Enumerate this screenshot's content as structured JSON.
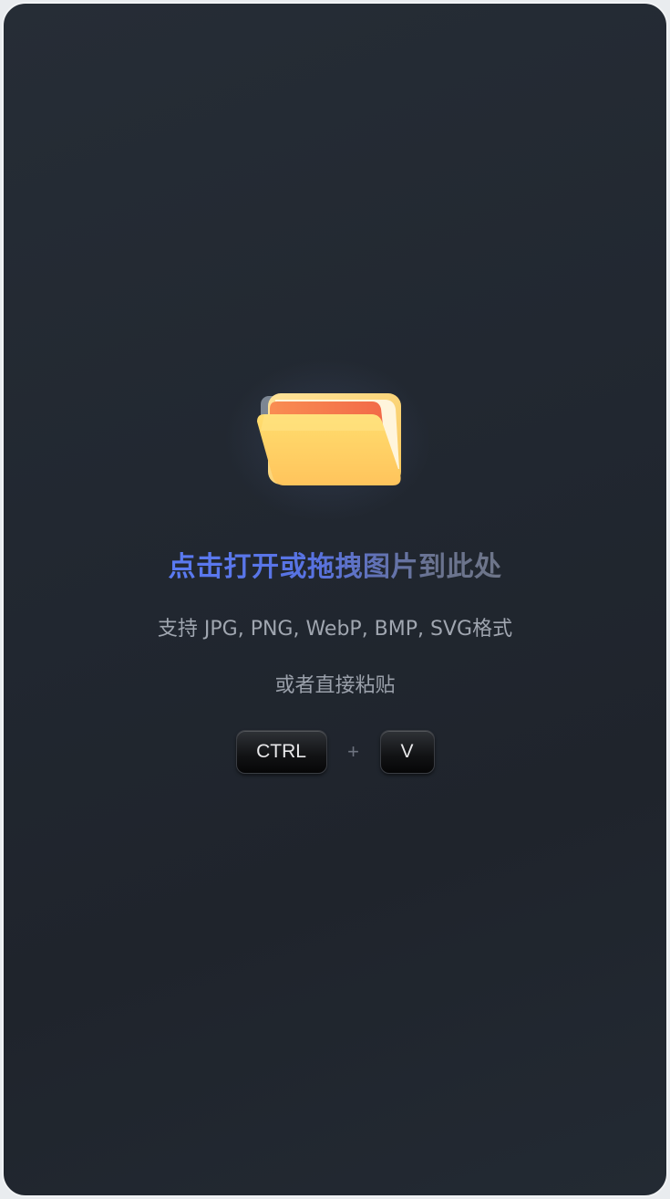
{
  "drop_zone": {
    "title": "点击打开或拖拽图片到此处",
    "formats": "支持 JPG, PNG, WebP, BMP, SVG格式",
    "paste_hint": "或者直接粘贴",
    "icon": "folder-icon"
  },
  "shortcut": {
    "keys": [
      "CTRL",
      "V"
    ],
    "separator": "+"
  },
  "colors": {
    "title_accent": "#5b7cf6",
    "folder_front": "#ffd166",
    "folder_tab": "#f5794a"
  }
}
